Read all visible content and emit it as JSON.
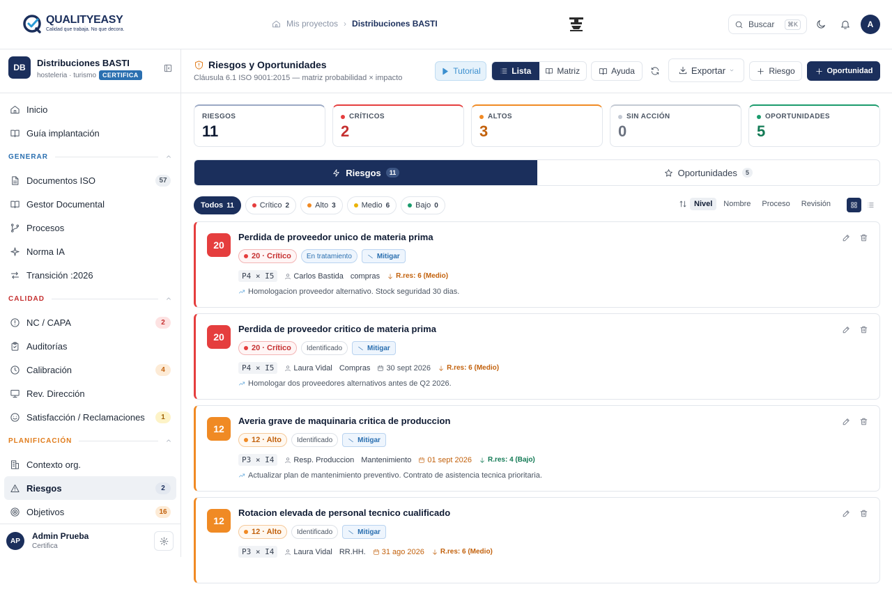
{
  "brand": {
    "name": "QUALITYEASY",
    "tagline": "Calidad que trabaja. No que decora."
  },
  "breadcrumb": {
    "parent": "Mis proyectos",
    "current": "Distribuciones BASTI"
  },
  "search": {
    "label": "Buscar",
    "shortcut": "⌘K"
  },
  "user_initial": "A",
  "org": {
    "initials": "DB",
    "name": "Distribuciones BASTI",
    "sector": "hosteleria · turismo",
    "badge": "CERTIFICA"
  },
  "nav_top": [
    {
      "label": "Inicio",
      "icon": "home-icon"
    },
    {
      "label": "Guía implantación",
      "icon": "book-icon"
    }
  ],
  "sections": [
    {
      "title": "GENERAR",
      "color": "#2a6fb0",
      "items": [
        {
          "label": "Documentos ISO",
          "icon": "document-icon",
          "count": "57",
          "count_style": "c-gray"
        },
        {
          "label": "Gestor Documental",
          "icon": "book-icon",
          "count": "",
          "count_style": ""
        },
        {
          "label": "Procesos",
          "icon": "process-icon",
          "count": "",
          "count_style": ""
        },
        {
          "label": "Norma IA",
          "icon": "sparkle-icon",
          "count": "",
          "count_style": ""
        },
        {
          "label": "Transición :2026",
          "icon": "swap-icon",
          "count": "",
          "count_style": ""
        }
      ]
    },
    {
      "title": "CALIDAD",
      "color": "#c53030",
      "items": [
        {
          "label": "NC / CAPA",
          "icon": "alert-circle-icon",
          "count": "2",
          "count_style": "c-red"
        },
        {
          "label": "Auditorías",
          "icon": "clipboard-icon",
          "count": "",
          "count_style": ""
        },
        {
          "label": "Calibración",
          "icon": "clock-icon",
          "count": "4",
          "count_style": "c-orange"
        },
        {
          "label": "Rev. Dirección",
          "icon": "monitor-icon",
          "count": "",
          "count_style": ""
        },
        {
          "label": "Satisfacción / Reclamaciones",
          "icon": "smile-icon",
          "count": "1",
          "count_style": "c-yellow"
        }
      ]
    },
    {
      "title": "PLANIFICACIÓN",
      "color": "#e07b1a",
      "items": [
        {
          "label": "Contexto org.",
          "icon": "building-icon",
          "count": "",
          "count_style": ""
        },
        {
          "label": "Riesgos",
          "icon": "warning-icon",
          "count": "2",
          "count_style": "c-blue",
          "active": true
        },
        {
          "label": "Objetivos",
          "icon": "target-icon",
          "count": "16",
          "count_style": "c-orange"
        }
      ]
    }
  ],
  "account": {
    "initials": "AP",
    "name": "Admin Prueba",
    "role": "Certifica"
  },
  "page": {
    "title": "Riesgos y Oportunidades",
    "subtitle": "Cláusula 6.1 ISO 9001:2015 — matriz probabilidad × impacto"
  },
  "toolbar": {
    "tutorial": "Tutorial",
    "list": "Lista",
    "matrix": "Matriz",
    "help": "Ayuda",
    "export": "Exportar",
    "add_risk": "Riesgo",
    "add_opportunity": "Oportunidad"
  },
  "stats": [
    {
      "label": "RIESGOS",
      "value": "11",
      "color": "#9aa8c4",
      "value_color": "#0f1b33",
      "dot": ""
    },
    {
      "label": "CRÍTICOS",
      "value": "2",
      "color": "#e53e3e",
      "value_color": "#c53030",
      "dot": "#e53e3e"
    },
    {
      "label": "ALTOS",
      "value": "3",
      "color": "#f08a24",
      "value_color": "#c2610c",
      "dot": "#f08a24"
    },
    {
      "label": "SIN ACCIÓN",
      "value": "0",
      "color": "#c3c9d3",
      "value_color": "#6b7280",
      "dot": "#c3c9d3"
    },
    {
      "label": "OPORTUNIDADES",
      "value": "5",
      "color": "#1a9b6c",
      "value_color": "#137a55",
      "dot": "#1a9b6c"
    }
  ],
  "tabs": [
    {
      "label": "Riesgos",
      "count": "11",
      "icon": "bolt-icon",
      "active": true
    },
    {
      "label": "Oportunidades",
      "count": "5",
      "icon": "star-icon",
      "active": false
    }
  ],
  "filters": [
    {
      "label": "Todos",
      "count": "11",
      "dot": "",
      "active": true
    },
    {
      "label": "Crítico",
      "count": "2",
      "dot": "#e53e3e",
      "active": false
    },
    {
      "label": "Alto",
      "count": "3",
      "dot": "#f08a24",
      "active": false
    },
    {
      "label": "Medio",
      "count": "6",
      "dot": "#eab308",
      "active": false
    },
    {
      "label": "Bajo",
      "count": "0",
      "dot": "#1a9b6c",
      "active": false
    }
  ],
  "sort": {
    "options": [
      "Nivel",
      "Nombre",
      "Proceso",
      "Revisión"
    ],
    "active": "Nivel"
  },
  "risks": [
    {
      "score": "20",
      "color": "#e53e3e",
      "title": "Perdida de proveedor unico de materia prima",
      "level": "20 · Crítico",
      "level_style": "tag-lvl-crit",
      "state": "En tratamiento",
      "state_style": "tag-state-blue",
      "strategy": "Mitigar",
      "pxi": "P4 × I5",
      "owner": "Carlos Bastida",
      "process": "compras",
      "date": "",
      "date_color": "",
      "rres": "R.res: 6 (Medio)",
      "rres_color": "#c2610c",
      "action": "Homologacion proveedor alternativo. Stock seguridad 30 dias."
    },
    {
      "score": "20",
      "color": "#e53e3e",
      "title": "Perdida de proveedor critico de materia prima",
      "level": "20 · Crítico",
      "level_style": "tag-lvl-crit",
      "state": "Identificado",
      "state_style": "tag-state-gray",
      "strategy": "Mitigar",
      "pxi": "P4 × I5",
      "owner": "Laura Vidal",
      "process": "Compras",
      "date": "30 sept 2026",
      "date_color": "#4b5563",
      "rres": "R.res: 6 (Medio)",
      "rres_color": "#c2610c",
      "action": "Homologar dos proveedores alternativos antes de Q2 2026."
    },
    {
      "score": "12",
      "color": "#f08a24",
      "title": "Averia grave de maquinaria critica de produccion",
      "level": "12 · Alto",
      "level_style": "tag-lvl-alto",
      "state": "Identificado",
      "state_style": "tag-state-gray",
      "strategy": "Mitigar",
      "pxi": "P3 × I4",
      "owner": "Resp. Produccion",
      "process": "Mantenimiento",
      "date": "01 sept 2026",
      "date_color": "#c2610c",
      "rres": "R.res: 4 (Bajo)",
      "rres_color": "#137a55",
      "action": "Actualizar plan de mantenimiento preventivo. Contrato de asistencia tecnica prioritaria."
    },
    {
      "score": "12",
      "color": "#f08a24",
      "title": "Rotacion elevada de personal tecnico cualificado",
      "level": "12 · Alto",
      "level_style": "tag-lvl-alto",
      "state": "Identificado",
      "state_style": "tag-state-gray",
      "strategy": "Mitigar",
      "pxi": "P3 × I4",
      "owner": "Laura Vidal",
      "process": "RR.HH.",
      "date": "31 ago 2026",
      "date_color": "#c2610c",
      "rres": "R.res: 6 (Medio)",
      "rres_color": "#c2610c",
      "action": ""
    }
  ]
}
